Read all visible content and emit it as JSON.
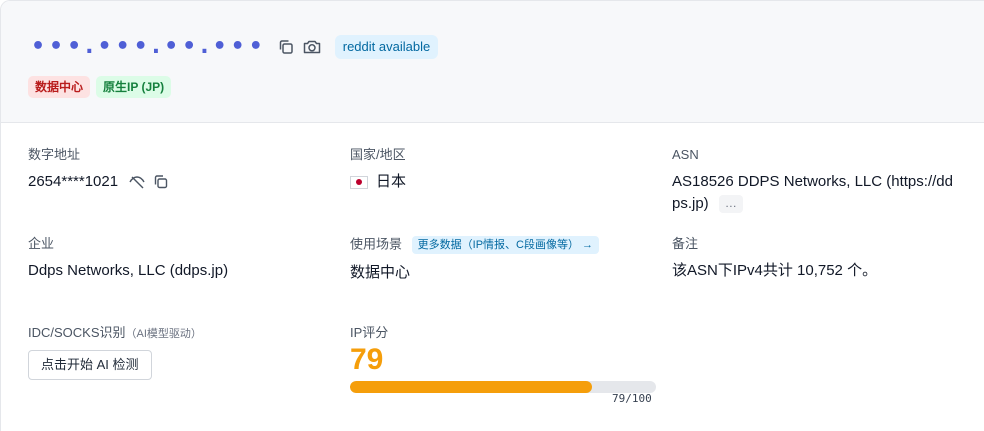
{
  "header": {
    "ip_masked": "•••.•••.••.•••",
    "reddit_badge": "reddit available",
    "tags": [
      "数据中心",
      "原生IP (JP)"
    ]
  },
  "fields": {
    "digital_address": {
      "label": "数字地址",
      "value": "2654****1021"
    },
    "country": {
      "label": "国家/地区",
      "value": "日本"
    },
    "asn": {
      "label": "ASN",
      "value_line1": "AS18526 DDPS Networks, LLC (https://dd",
      "value_line2": "ps.jp)",
      "more": "…"
    },
    "enterprise": {
      "label": "企业",
      "value": "Ddps Networks, LLC (ddps.jp)"
    },
    "usage": {
      "label": "使用场景",
      "link": "更多数据（IP情报、C段画像等） →",
      "value": "数据中心"
    },
    "notes": {
      "label": "备注",
      "value": "该ASN下IPv4共计 10,752 个。"
    },
    "idc": {
      "label": "IDC/SOCKS识别",
      "note": "（AI模型驱动）",
      "button": "点击开始 AI 检测"
    },
    "ip_score": {
      "label": "IP评分",
      "score": "79",
      "fraction": 0.79,
      "score_text": "79/100"
    }
  },
  "colors": {
    "accent_orange": "#f59e0b",
    "ip_blue": "#4f5fd6",
    "tag_red_bg": "#fde2e2",
    "tag_green_bg": "#dcfce7"
  },
  "icons": [
    "copy-icon",
    "camera-icon",
    "eye-off-icon",
    "copy-icon",
    "japan-flag-icon"
  ]
}
